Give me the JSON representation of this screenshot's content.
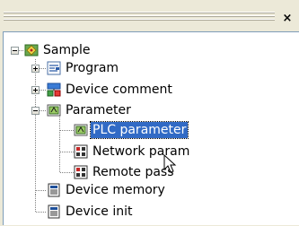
{
  "toolbar": {
    "close_glyph": "×"
  },
  "tree": {
    "root": {
      "label": "Sample",
      "expanded": true,
      "icon": "project-icon"
    },
    "items": [
      {
        "label": "Program",
        "icon": "program-icon",
        "expandable": true,
        "expanded": false
      },
      {
        "label": "Device comment",
        "icon": "device-comment-icon",
        "expandable": true,
        "expanded": false
      },
      {
        "label": "Parameter",
        "icon": "parameter-folder-icon",
        "expandable": true,
        "expanded": true,
        "children": [
          {
            "label": "PLC parameter",
            "icon": "plc-parameter-icon",
            "selected": true
          },
          {
            "label": "Network param",
            "icon": "network-param-icon",
            "selected": false
          },
          {
            "label": "Remote pass",
            "icon": "remote-pass-icon",
            "selected": false
          }
        ]
      },
      {
        "label": "Device memory",
        "icon": "device-memory-icon",
        "expandable": false
      },
      {
        "label": "Device init",
        "icon": "device-init-icon",
        "expandable": false
      }
    ]
  },
  "colors": {
    "selection": "#316ac5",
    "panel_border": "#7f9db9",
    "background": "#ece9d8"
  }
}
